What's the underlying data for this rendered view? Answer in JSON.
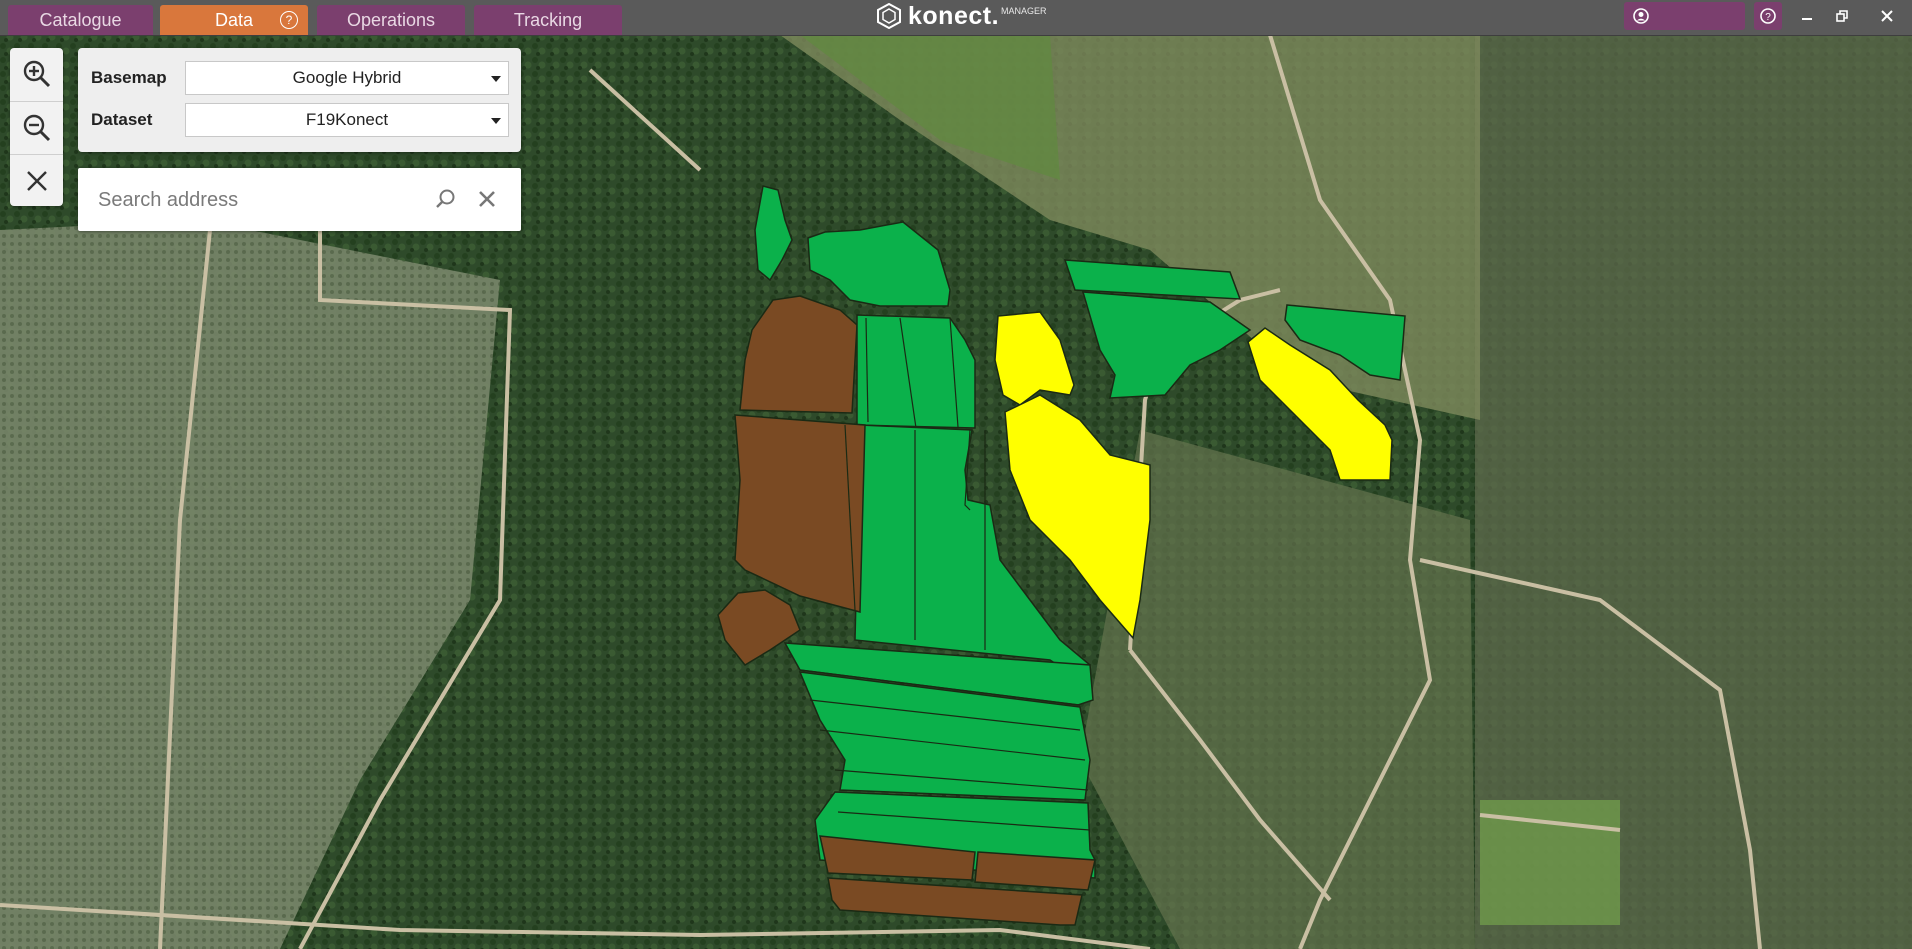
{
  "tabs": [
    {
      "label": "Catalogue",
      "active": false
    },
    {
      "label": "Data",
      "active": true
    },
    {
      "label": "Operations",
      "active": false
    },
    {
      "label": "Tracking",
      "active": false
    }
  ],
  "brand": {
    "name": "konect.",
    "sub": "MANAGER"
  },
  "colors": {
    "tab": "#7b3f6e",
    "tab_active": "#d9773c",
    "paddock_green": "#0bb14b",
    "paddock_brown": "#7a4a23",
    "paddock_yellow": "#ffff00"
  },
  "map_controls": {
    "zoom_in_icon": "zoom-in-icon",
    "zoom_out_icon": "zoom-out-icon",
    "close_icon": "close-icon"
  },
  "panel": {
    "basemap_label": "Basemap",
    "basemap_value": "Google Hybrid",
    "dataset_label": "Dataset",
    "dataset_value": "F19Konect"
  },
  "search": {
    "placeholder": "Search address",
    "search_icon": "search-icon",
    "clear_icon": "close-icon"
  },
  "paddocks": [
    {
      "id": "g1",
      "status": "green"
    },
    {
      "id": "g2",
      "status": "green"
    },
    {
      "id": "b1",
      "status": "brown"
    },
    {
      "id": "g3",
      "status": "green"
    },
    {
      "id": "g4",
      "status": "green"
    },
    {
      "id": "g5",
      "status": "green"
    },
    {
      "id": "y1",
      "status": "yellow"
    },
    {
      "id": "y2",
      "status": "yellow"
    },
    {
      "id": "g6",
      "status": "green"
    },
    {
      "id": "g7",
      "status": "green"
    },
    {
      "id": "g8",
      "status": "green"
    },
    {
      "id": "y3",
      "status": "yellow"
    },
    {
      "id": "b2",
      "status": "brown"
    },
    {
      "id": "b3",
      "status": "brown"
    },
    {
      "id": "g9",
      "status": "green"
    },
    {
      "id": "g10",
      "status": "green"
    },
    {
      "id": "g11",
      "status": "green"
    },
    {
      "id": "b4",
      "status": "brown"
    },
    {
      "id": "b5",
      "status": "brown"
    },
    {
      "id": "b6",
      "status": "brown"
    }
  ]
}
